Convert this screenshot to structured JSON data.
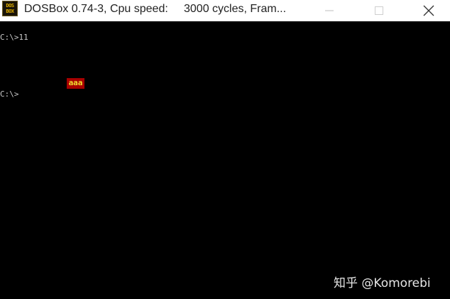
{
  "window": {
    "title": "DOSBox 0.74-3, Cpu speed:     3000 cycles, Fram...",
    "icon_lines": [
      "DOS",
      "BOX"
    ],
    "controls": [
      "minimize-icon",
      "maximize-icon",
      "close-icon"
    ]
  },
  "console": {
    "line1": "C:\\>11",
    "highlight_text": "aaa",
    "line2": "C:\\>",
    "highlight_bg": "#a80000",
    "highlight_fg": "#f0e030"
  },
  "watermark": "知乎 @Komorebi"
}
